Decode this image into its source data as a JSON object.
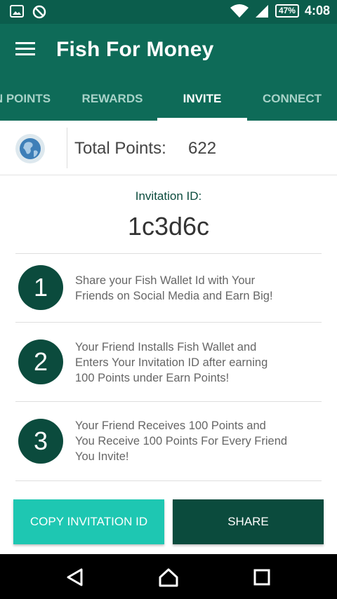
{
  "status_bar": {
    "battery": "47%",
    "time": "4:08",
    "icons": [
      "image-icon",
      "no-sync-icon",
      "wifi-icon",
      "signal-icon",
      "battery-icon"
    ]
  },
  "app_bar": {
    "title": "Fish For Money",
    "menu_icon": "hamburger-menu-icon"
  },
  "tabs": [
    {
      "label": "N POINTS",
      "active": false
    },
    {
      "label": "REWARDS",
      "active": false
    },
    {
      "label": "INVITE",
      "active": true
    },
    {
      "label": "CONNECT",
      "active": false
    }
  ],
  "points": {
    "label": "Total Points:",
    "value": "622",
    "icon": "globe-icon"
  },
  "invitation": {
    "label": "Invitation ID:",
    "code": "1c3d6c"
  },
  "steps": [
    {
      "number": "1",
      "text": "Share your Fish Wallet Id with Your\nFriends on Social Media and Earn Big!"
    },
    {
      "number": "2",
      "text": "Your Friend Installs Fish Wallet and\nEnters Your Invitation ID after earning\n100 Points under Earn Points!"
    },
    {
      "number": "3",
      "text": "Your Friend Receives 100 Points and\n You Receive 100 Points For Every Friend\nYou Invite!"
    }
  ],
  "buttons": {
    "copy": "COPY INVITATION ID",
    "share": "SHARE"
  },
  "colors": {
    "status_bar": "#0b5d4c",
    "app_bar": "#0e6b58",
    "step_circle": "#0b4b3d",
    "copy_button": "#1ec7b2",
    "share_button": "#0b4b3d"
  },
  "nav": [
    "back-icon",
    "home-icon",
    "recents-icon"
  ]
}
